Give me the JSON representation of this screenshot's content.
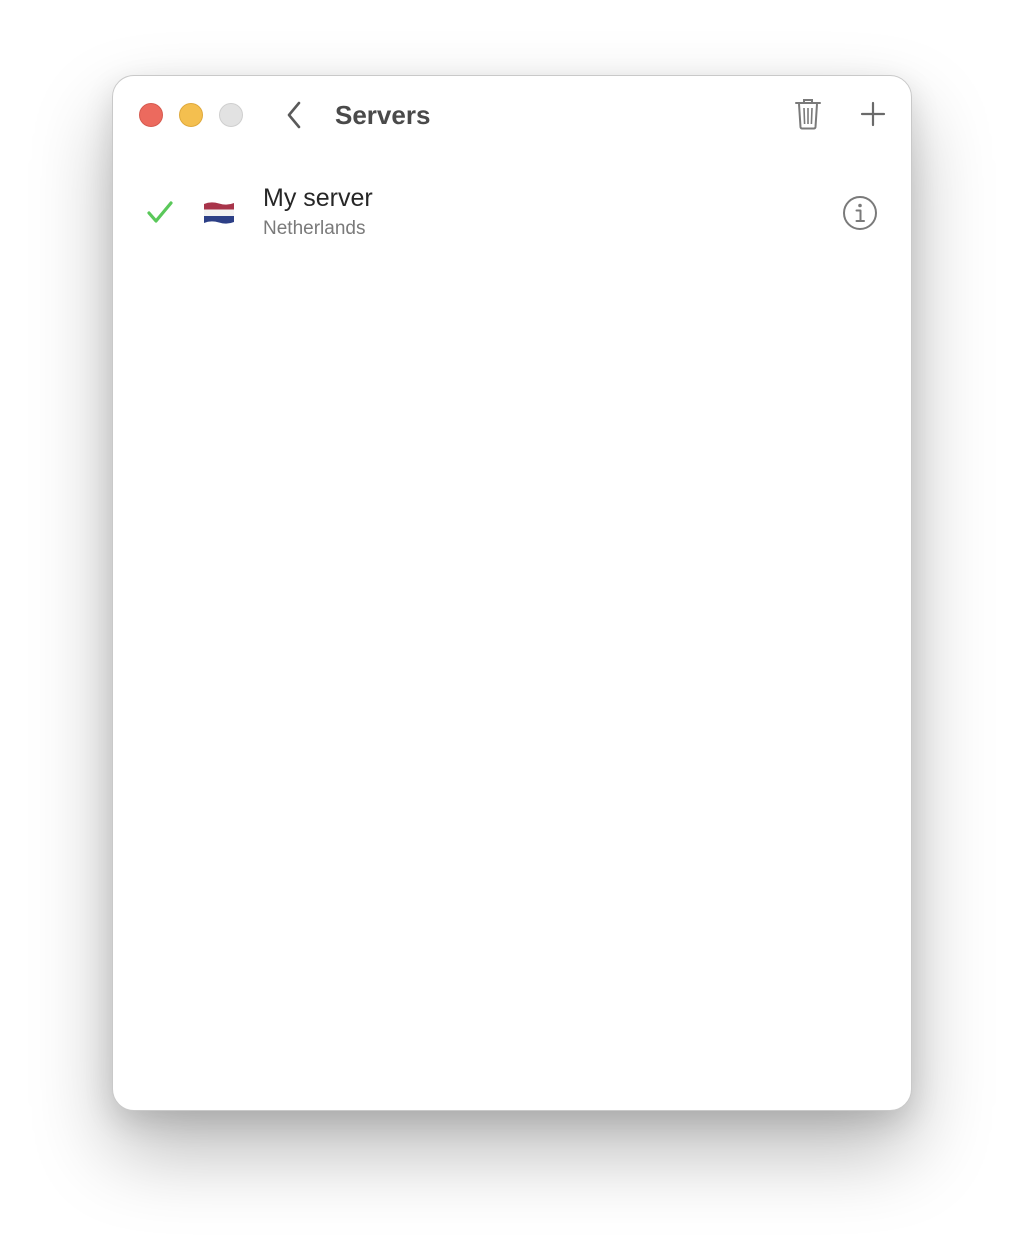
{
  "window": {
    "title": "Servers",
    "controls": {
      "close_color": "#ec6a5e",
      "minimize_color": "#f4bf4f",
      "zoom_color": "#e2e2e2"
    }
  },
  "toolbar": {
    "back_icon": "chevron-left-icon",
    "delete_icon": "trash-icon",
    "add_icon": "plus-icon"
  },
  "servers": [
    {
      "name": "My server",
      "location": "Netherlands",
      "selected": true,
      "flag_icon": "netherlands-flag-icon",
      "status_icon": "checkmark-icon",
      "info_icon": "info-icon"
    }
  ],
  "colors": {
    "check": "#5ac85a",
    "icon_gray": "#7a7a7a"
  }
}
